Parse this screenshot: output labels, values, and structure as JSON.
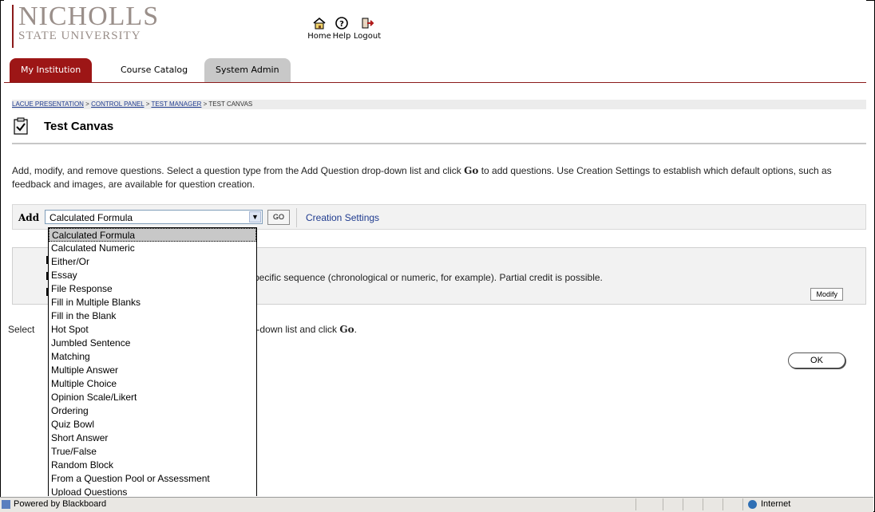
{
  "logo": {
    "main": "NICHOLLS",
    "sub": "STATE UNIVERSITY"
  },
  "topnav": {
    "home": {
      "label": "Home",
      "icon": "home-icon"
    },
    "help": {
      "label": "Help",
      "icon": "help-icon"
    },
    "logout": {
      "label": "Logout",
      "icon": "logout-icon"
    }
  },
  "tabs": [
    {
      "label": "My Institution"
    },
    {
      "label": "Course Catalog"
    },
    {
      "label": "System Admin"
    }
  ],
  "breadcrumb": {
    "items": [
      "LACUE PRESENTATION",
      "CONTROL PANEL",
      "TEST MANAGER"
    ],
    "current": "TEST CANVAS",
    "separator": " > "
  },
  "page": {
    "title": "Test Canvas"
  },
  "description": {
    "part1": "Add, modify, and remove questions. Select a question type from the Add Question drop-down list and click ",
    "bold": "Go",
    "part2": " to add questions. Use Creation Settings to establish which default options, such as feedback and images, are available for question creation."
  },
  "addbar": {
    "label": "Add",
    "selected": "Calculated Formula",
    "go_label": "GO",
    "creation_settings": "Creation Settings"
  },
  "question": {
    "text": "pecific sequence (chronological or numeric, for example). Partial credit is possible.",
    "modify_label": "Modify"
  },
  "instruction": {
    "prefix": "Select",
    "text": "op-down list and click ",
    "bold": "Go",
    "end": "."
  },
  "ok_label": "OK",
  "dropdown_options": [
    "Calculated Formula",
    "Calculated Numeric",
    "Either/Or",
    "Essay",
    "File Response",
    "Fill in Multiple Blanks",
    "Fill in the Blank",
    "Hot Spot",
    "Jumbled Sentence",
    "Matching",
    "Multiple Answer",
    "Multiple Choice",
    "Opinion Scale/Likert",
    "Ordering",
    "Quiz Bowl",
    "Short Answer",
    "True/False",
    "Random Block",
    "From a Question Pool or Assessment",
    "Upload Questions"
  ],
  "status": {
    "left": "Powered by Blackboard",
    "zone": "Internet"
  },
  "colors": {
    "tab_active": "#9d1616",
    "link": "#1f3b8f",
    "tab_grey": "#c8c8c8"
  }
}
